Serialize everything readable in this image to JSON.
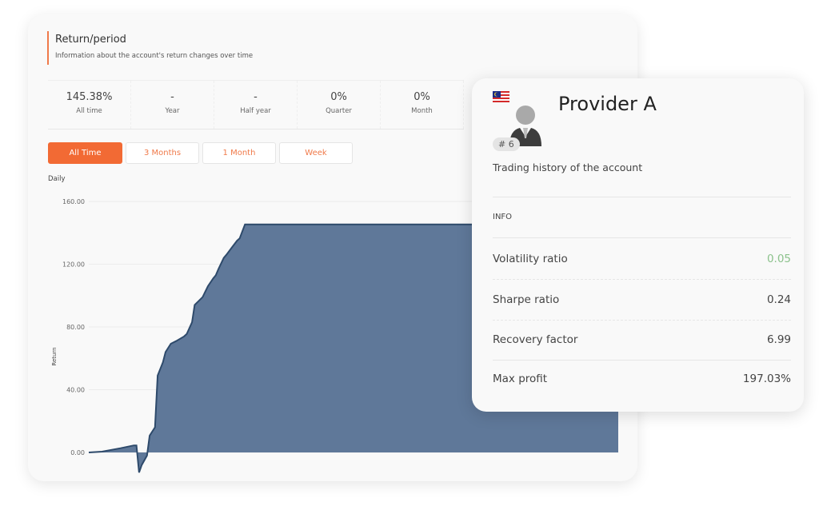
{
  "return_panel": {
    "title": "Return/period",
    "subtitle": "Information about the account's return changes over time",
    "stats": [
      {
        "value": "145.38%",
        "label": "All time"
      },
      {
        "value": "-",
        "label": "Year"
      },
      {
        "value": "-",
        "label": "Half year"
      },
      {
        "value": "0%",
        "label": "Quarter"
      },
      {
        "value": "0%",
        "label": "Month"
      }
    ],
    "range_buttons": [
      {
        "label": "All Time",
        "active": true
      },
      {
        "label": "3 Months",
        "active": false
      },
      {
        "label": "1 Month",
        "active": false
      },
      {
        "label": "Week",
        "active": false
      }
    ],
    "frequency_label": "Daily",
    "accent_color": "#f26a34"
  },
  "chart_data": {
    "type": "area",
    "xlabel": "",
    "ylabel": "Return",
    "ylim": [
      -13,
      160
    ],
    "yticks": [
      0,
      40,
      80,
      120,
      160
    ],
    "ytick_labels": [
      "0.00",
      "40.00",
      "80.00",
      "120.00",
      "160.00"
    ],
    "grid": true,
    "fill_color": "#5f7899",
    "line_color": "#2e4a6b",
    "x": [
      0,
      5,
      12,
      17,
      18,
      19,
      20,
      22,
      23,
      25,
      26,
      28,
      29,
      31,
      33,
      36,
      37,
      39,
      40,
      43,
      45,
      47,
      48,
      49,
      51,
      52,
      54,
      56,
      57,
      59,
      200
    ],
    "values": [
      0,
      0.5,
      2.7,
      4.5,
      4.5,
      -12.8,
      -8,
      -2,
      10.7,
      16,
      49,
      57.5,
      64,
      69.3,
      71,
      74,
      75.5,
      83,
      94,
      99,
      106,
      111,
      113,
      117,
      124,
      126,
      130.5,
      135,
      136.5,
      145.38,
      145.38
    ]
  },
  "provider": {
    "flag": "malaysia-flag",
    "name": "Provider A",
    "rank": "# 6",
    "description": "Trading history of the account",
    "info_heading": "INFO",
    "metrics": [
      {
        "label": "Volatility ratio",
        "value": "0.05",
        "color": "#8cc28c"
      },
      {
        "label": "Sharpe ratio",
        "value": "0.24",
        "color": "#444444"
      },
      {
        "label": "Recovery factor",
        "value": "6.99",
        "color": "#444444"
      },
      {
        "label": "Max profit",
        "value": "197.03%",
        "color": "#444444"
      }
    ]
  }
}
